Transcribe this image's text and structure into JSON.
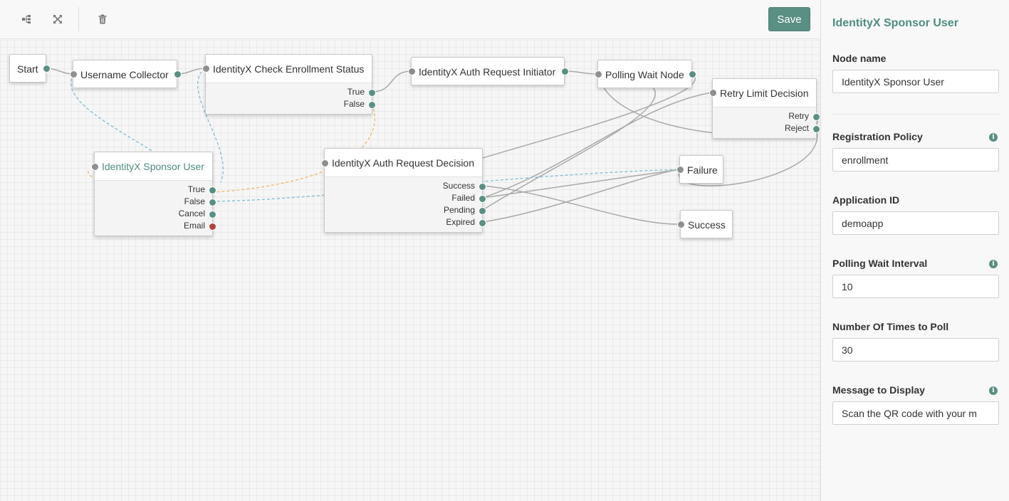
{
  "toolbar": {
    "layout_icon": "tree-layout-icon",
    "fullscreen_icon": "expand-arrows-icon",
    "delete_icon": "trash-icon",
    "save_label": "Save"
  },
  "colors": {
    "accent": "#5a8f84",
    "accent_text": "#4d8d80",
    "port_gray": "#8f8f8f",
    "port_red": "#b3433c",
    "wire_gray": "#a9a9a9",
    "wire_blue": "#7dbcd4",
    "wire_orange": "#f0b660"
  },
  "nodes": {
    "start": {
      "title": "Start"
    },
    "username_collector": {
      "title": "Username Collector"
    },
    "check_enrollment": {
      "title": "IdentityX Check Enrollment Status",
      "outcomes": [
        "True",
        "False"
      ]
    },
    "auth_initiator": {
      "title": "IdentityX Auth Request Initiator"
    },
    "polling_wait": {
      "title": "Polling Wait Node"
    },
    "retry_limit": {
      "title": "Retry Limit Decision",
      "outcomes": [
        "Retry",
        "Reject"
      ]
    },
    "sponsor_user": {
      "title": "IdentityX Sponsor User",
      "outcomes": [
        "True",
        "False",
        "Cancel",
        "Email"
      ]
    },
    "auth_decision": {
      "title": "IdentityX Auth Request Decision",
      "outcomes": [
        "Success",
        "Failed",
        "Pending",
        "Expired"
      ]
    },
    "failure": {
      "title": "Failure"
    },
    "success": {
      "title": "Success"
    }
  },
  "panel": {
    "title": "IdentityX Sponsor User",
    "fields": {
      "node_name": {
        "label": "Node name",
        "value": "IdentityX Sponsor User"
      },
      "registration_policy": {
        "label": "Registration Policy",
        "value": "enrollment",
        "info": "i"
      },
      "application_id": {
        "label": "Application ID",
        "value": "demoapp"
      },
      "polling_wait_interval": {
        "label": "Polling Wait Interval",
        "value": "10",
        "info": "i"
      },
      "number_of_times": {
        "label": "Number Of Times to Poll",
        "value": "30"
      },
      "message_to_display": {
        "label": "Message to Display",
        "value": "Scan the QR code with your m",
        "info": "i"
      }
    }
  }
}
